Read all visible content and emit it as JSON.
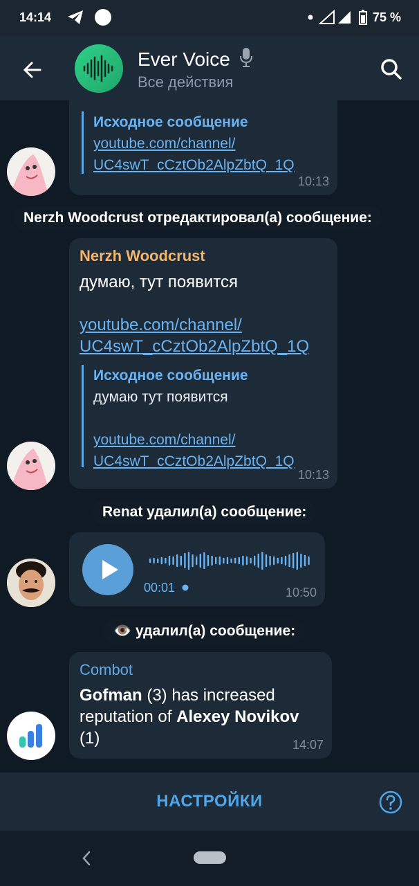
{
  "status": {
    "time": "14:14",
    "battery": "75 %"
  },
  "header": {
    "title": "Ever Voice",
    "subtitle": "Все действия"
  },
  "messages": {
    "m1": {
      "quote_title": "Исходное сообщение",
      "quote_link1": "youtube.com/channel/",
      "quote_link2": "UC4swT_cCztOb2AlpZbtQ_1Q",
      "time": "10:13"
    },
    "service1": "Nerzh Woodcrust отредактировал(а) сообщение:",
    "m2": {
      "sender": "Nerzh Woodcrust",
      "text": "думаю, тут появится",
      "link1": "youtube.com/channel/",
      "link2": "UC4swT_cCztOb2AlpZbtQ_1Q",
      "quote_title": "Исходное сообщение",
      "quote_text": "думаю тут появится",
      "quote_link1": "youtube.com/channel/",
      "quote_link2": "UC4swT_cCztOb2AlpZbtQ_1Q",
      "time": "10:13"
    },
    "service2": "Renat удалил(а) сообщение:",
    "m3": {
      "duration": "00:01",
      "time": "10:50"
    },
    "service3": "удалил(а) сообщение:",
    "m4": {
      "sender": "Combot",
      "bold1": "Gofman",
      "text1": " (3) has increased",
      "text2": "reputation of ",
      "bold2": "Alexey Novikov",
      "text3": "(1)",
      "time": "14:07"
    }
  },
  "bottom": {
    "settings_label": "НАСТРОЙКИ"
  },
  "colors": {
    "accent": "#6ab3f3",
    "sender_orange": "#f2b56b",
    "combot_blue": "#5ea9e6"
  },
  "icons": [
    "telegram-icon",
    "circle-icon",
    "signal-icon",
    "battery-icon",
    "back-arrow-icon",
    "waveform-icon",
    "microphone-icon",
    "search-icon",
    "play-icon",
    "eye-icon",
    "chart-icon",
    "help-icon",
    "nav-back-icon"
  ]
}
